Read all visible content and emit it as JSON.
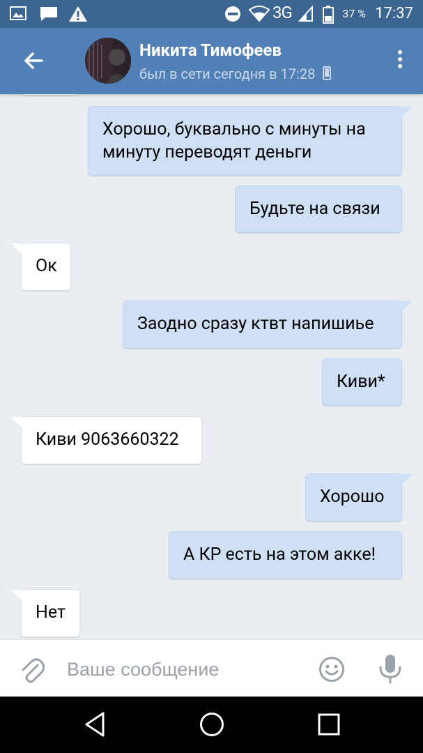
{
  "status_bar": {
    "network": "3G",
    "battery": "37 %",
    "time": "17:37",
    "icons": [
      "image-icon",
      "message-icon",
      "warning-icon",
      "do-not-disturb-icon",
      "wifi-icon",
      "signal-icon",
      "battery-icon"
    ]
  },
  "header": {
    "contact_name": "Никита Тимофеев",
    "contact_status": "был в сети сегодня в 17:28",
    "icons": [
      "back-arrow-icon",
      "mobile-phone-icon",
      "more-vert-icon"
    ]
  },
  "messages": [
    {
      "direction": "out",
      "text": "Хорошо, буквально с минуты на минуту переводят деньги"
    },
    {
      "direction": "out",
      "text": "Будьте на связи"
    },
    {
      "direction": "in",
      "text": "Ок"
    },
    {
      "direction": "out",
      "text": "Заодно сразу ктвт напишиье"
    },
    {
      "direction": "out",
      "text": "Киви*"
    },
    {
      "direction": "in",
      "text": "Киви 9063660322"
    },
    {
      "direction": "out",
      "text": "Хорошо"
    },
    {
      "direction": "out",
      "text": "А КР есть на этом акке!"
    },
    {
      "direction": "in",
      "text": "Нет"
    }
  ],
  "input": {
    "placeholder": "Ваше сообщение",
    "value": "",
    "icons": [
      "attach-icon",
      "smile-icon",
      "microphone-icon"
    ]
  },
  "nav_bar": {
    "icons": [
      "back-triangle-icon",
      "home-circle-icon",
      "recents-square-icon"
    ]
  },
  "colors": {
    "status_bar": "#3d6591",
    "header": "#5180b6",
    "chat_background": "#eaeef2",
    "outgoing_bubble": "#cfe0f5",
    "incoming_bubble": "#ffffff"
  }
}
